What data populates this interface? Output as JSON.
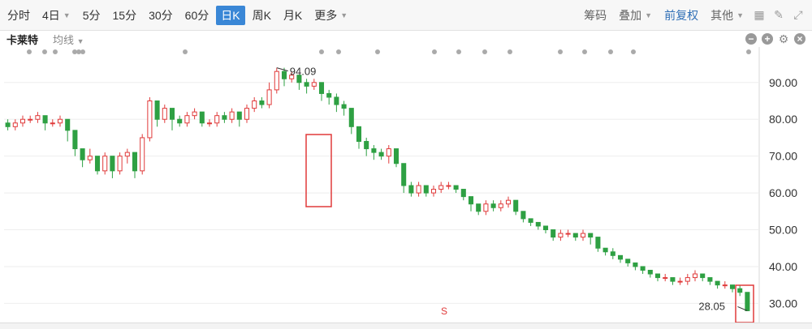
{
  "toolbar": {
    "periods": [
      "分时",
      "4日",
      "5分",
      "15分",
      "30分",
      "60分",
      "日K",
      "周K",
      "月K",
      "更多"
    ],
    "active_period": "日K",
    "right_items": [
      "筹码",
      "叠加",
      "前复权",
      "其他"
    ]
  },
  "subbar": {
    "stock_name": "卡莱特",
    "ma_label": "均线"
  },
  "chart_data": {
    "type": "candlestick",
    "y_ticks": [
      "90.00",
      "80.00",
      "70.00",
      "60.00",
      "50.00",
      "40.00",
      "30.00"
    ],
    "ylim": [
      27,
      97
    ],
    "high_label": "94.09",
    "low_label": "28.05",
    "marker_label": "S",
    "up_color": "#e03a3a",
    "down_color": "#2ea043",
    "candles": [
      [
        79,
        78,
        80,
        77
      ],
      [
        78,
        79,
        80,
        77
      ],
      [
        79,
        80,
        81,
        78
      ],
      [
        80,
        80,
        81,
        79
      ],
      [
        80,
        81,
        82,
        79
      ],
      [
        81,
        79,
        81,
        77
      ],
      [
        79,
        79,
        80,
        78
      ],
      [
        79,
        80,
        81,
        78
      ],
      [
        80,
        77,
        80,
        74
      ],
      [
        77,
        72,
        77,
        70
      ],
      [
        72,
        69,
        72,
        67
      ],
      [
        69,
        70,
        72,
        68
      ],
      [
        70,
        66,
        70,
        65
      ],
      [
        66,
        70,
        71,
        65
      ],
      [
        70,
        66,
        70,
        64
      ],
      [
        66,
        70,
        71,
        65
      ],
      [
        70,
        71,
        72,
        68
      ],
      [
        71,
        66,
        71,
        64
      ],
      [
        66,
        75,
        76,
        65
      ],
      [
        75,
        85,
        86,
        74
      ],
      [
        85,
        80,
        85,
        78
      ],
      [
        80,
        83,
        84,
        79
      ],
      [
        83,
        80,
        83,
        77
      ],
      [
        80,
        79,
        81,
        78
      ],
      [
        79,
        81,
        82,
        78
      ],
      [
        81,
        82,
        83,
        80
      ],
      [
        82,
        79,
        82,
        78
      ],
      [
        79,
        79,
        80,
        78
      ],
      [
        79,
        81,
        82,
        78
      ],
      [
        81,
        80,
        82,
        79
      ],
      [
        80,
        82,
        83,
        79
      ],
      [
        82,
        80,
        82,
        78
      ],
      [
        80,
        83,
        84,
        79
      ],
      [
        83,
        85,
        86,
        82
      ],
      [
        85,
        84,
        86,
        83
      ],
      [
        84,
        88,
        90,
        83
      ],
      [
        88,
        93,
        94,
        87
      ],
      [
        93,
        91,
        94,
        89
      ],
      [
        91,
        92,
        93,
        90
      ],
      [
        92,
        90,
        92,
        88
      ],
      [
        90,
        89,
        91,
        87
      ],
      [
        89,
        90,
        91,
        88
      ],
      [
        90,
        87,
        90,
        85
      ],
      [
        87,
        86,
        88,
        84
      ],
      [
        86,
        84,
        87,
        82
      ],
      [
        84,
        83,
        85,
        81
      ],
      [
        83,
        78,
        83,
        76
      ],
      [
        78,
        74,
        78,
        72
      ],
      [
        74,
        72,
        75,
        70
      ],
      [
        72,
        71,
        73,
        69
      ],
      [
        71,
        70,
        72,
        69
      ],
      [
        70,
        72,
        73,
        68
      ],
      [
        72,
        68,
        72,
        67
      ],
      [
        68,
        62,
        68,
        60
      ],
      [
        62,
        60,
        63,
        59
      ],
      [
        60,
        62,
        63,
        59
      ],
      [
        62,
        60,
        62,
        59
      ],
      [
        60,
        61,
        62,
        59
      ],
      [
        61,
        62,
        63,
        60
      ],
      [
        62,
        62,
        63,
        61
      ],
      [
        62,
        61,
        62,
        60
      ],
      [
        61,
        59,
        61,
        58
      ],
      [
        59,
        57,
        59,
        55
      ],
      [
        57,
        55,
        57,
        54
      ],
      [
        55,
        57,
        58,
        54
      ],
      [
        57,
        56,
        58,
        55
      ],
      [
        56,
        57,
        58,
        55
      ],
      [
        57,
        58,
        59,
        56
      ],
      [
        58,
        55,
        58,
        54
      ],
      [
        55,
        53,
        55,
        52
      ],
      [
        53,
        52,
        53,
        51
      ],
      [
        52,
        51,
        52,
        50
      ],
      [
        51,
        50,
        51,
        49
      ],
      [
        50,
        48,
        50,
        47
      ],
      [
        48,
        49,
        50,
        47
      ],
      [
        49,
        49,
        50,
        48
      ],
      [
        49,
        48,
        49,
        47
      ],
      [
        48,
        49,
        50,
        47
      ],
      [
        49,
        48,
        49,
        46
      ],
      [
        48,
        45,
        48,
        44
      ],
      [
        45,
        44,
        45,
        43
      ],
      [
        44,
        43,
        45,
        42
      ],
      [
        43,
        42,
        43,
        41
      ],
      [
        42,
        41,
        42,
        40
      ],
      [
        41,
        40,
        41,
        39
      ],
      [
        40,
        39,
        40,
        38
      ],
      [
        39,
        38,
        39,
        37
      ],
      [
        38,
        37,
        38,
        36
      ],
      [
        37,
        37,
        38,
        36
      ],
      [
        37,
        36,
        37,
        35
      ],
      [
        36,
        36,
        37,
        35
      ],
      [
        36,
        37,
        38,
        35
      ],
      [
        37,
        38,
        39,
        36
      ],
      [
        38,
        37,
        38,
        36
      ],
      [
        37,
        36,
        37,
        35
      ],
      [
        36,
        35,
        36,
        34
      ],
      [
        35,
        35,
        36,
        34
      ],
      [
        35,
        34,
        35,
        33
      ],
      [
        34,
        33,
        35,
        32
      ],
      [
        33,
        28,
        33,
        28
      ]
    ]
  }
}
